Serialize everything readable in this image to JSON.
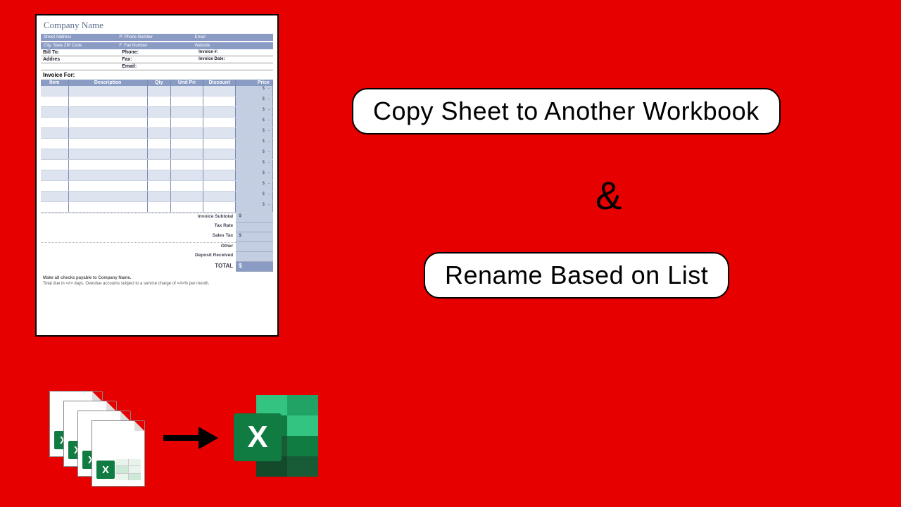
{
  "pills": {
    "line1": "Copy Sheet to Another Workbook",
    "amp": "&",
    "line2": "Rename Based on List"
  },
  "invoice": {
    "company": "Company Name",
    "head1": {
      "a": "Street Address",
      "b": "P: Phone Number",
      "c": "Email"
    },
    "head2": {
      "a": "City, State ZIP Code",
      "b": "F: Fax Number",
      "c": "Website"
    },
    "billto": "Bill To:",
    "address": "Addres",
    "phone": "Phone:",
    "fax": "Fax:",
    "email": "Email:",
    "invoice_no": "Invoice #:",
    "invoice_date": "Invoice Date:",
    "invoice_for": "Invoice For:",
    "cols": {
      "item": "Item",
      "desc": "Description",
      "qty": "Qty",
      "up": "Unit Pri",
      "disc": "Discount",
      "price": "Price"
    },
    "currency": "$",
    "dash": "-",
    "sum": {
      "subtotal": "Invoice Subtotal",
      "taxrate": "Tax Rate",
      "salestax": "Sales Tax",
      "other": "Other",
      "deposit": "Deposit Received",
      "total": "TOTAL"
    },
    "foot1": "Make all checks payable to Company Name.",
    "foot2": "Total due in <#> days. Overdue accounts subject to a service charge of <#>% per month."
  },
  "icons": {
    "x": "X",
    "arrow": "arrow"
  }
}
